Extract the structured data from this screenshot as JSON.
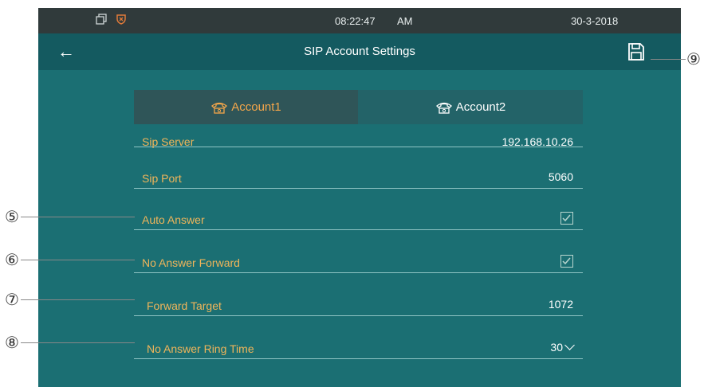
{
  "status_bar": {
    "icons": [
      "copy-icon",
      "shield-icon"
    ],
    "time": "08:22:47",
    "ampm": "AM",
    "date": "30-3-2018"
  },
  "title_bar": {
    "back_icon": "arrow-left-icon",
    "title": "SIP Account Settings",
    "save_icon": "floppy-disk-icon"
  },
  "tabs": [
    {
      "label": "Account1",
      "icon": "telephone-icon",
      "selected": true
    },
    {
      "label": "Account2",
      "icon": "telephone-icon",
      "selected": false
    }
  ],
  "rows": [
    {
      "label": "Sip Server",
      "value": "192.168.10.26",
      "partial": true
    },
    {
      "label": "Sip Port",
      "value": "5060"
    },
    {
      "label": "Auto Answer",
      "checked": true
    },
    {
      "label": "No Answer Forward",
      "checked": true
    },
    {
      "label": "Forward Target",
      "value": "1072"
    },
    {
      "label": "No Answer Ring Time",
      "value": "30"
    }
  ],
  "callouts": [
    "⑤",
    "⑥",
    "⑦",
    "⑧",
    "⑨"
  ],
  "colors": {
    "screen_bg": "#1b6f73",
    "status_bg": "#303a3b",
    "title_bg": "#145a60",
    "label_orange": "#f0b55a",
    "active_tab_text": "#f4a64a"
  }
}
